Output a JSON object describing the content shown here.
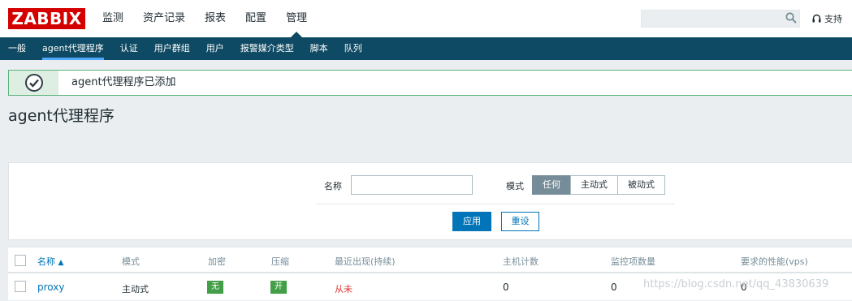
{
  "brand": {
    "logo": "ZABBIX",
    "accent": "#d40000"
  },
  "main_nav": {
    "items": [
      "监测",
      "资产记录",
      "报表",
      "配置",
      "管理"
    ],
    "active": "管理"
  },
  "search": {
    "value": "",
    "placeholder": "",
    "icon": "search-icon"
  },
  "support": {
    "label": "支持",
    "icon": "headset-icon"
  },
  "sub_nav": {
    "items": [
      "一般",
      "agent代理程序",
      "认证",
      "用户群组",
      "用户",
      "报警媒介类型",
      "脚本",
      "队列"
    ],
    "active": "agent代理程序"
  },
  "message": {
    "text": "agent代理程序已添加",
    "icon": "check-circle-icon",
    "status_color": "#59b37a"
  },
  "page": {
    "title": "agent代理程序"
  },
  "filter": {
    "name_label": "名称",
    "name_value": "",
    "mode_label": "模式",
    "mode_options": [
      "任何",
      "主动式",
      "被动式"
    ],
    "mode_selected": "任何",
    "apply_label": "应用",
    "reset_label": "重设"
  },
  "table": {
    "columns": [
      "名称",
      "模式",
      "加密",
      "压缩",
      "最近出现(持续)",
      "主机计数",
      "监控项数量",
      "要求的性能(vps)"
    ],
    "sort_indicator": "▲",
    "rows": [
      {
        "name": "proxy",
        "mode": "主动式",
        "encryption": "无",
        "compression": "开",
        "last_seen": "从未",
        "host_count": "0",
        "item_count": "0",
        "vps": "0"
      }
    ]
  },
  "watermark": "https://blog.csdn.net/qq_43830639"
}
